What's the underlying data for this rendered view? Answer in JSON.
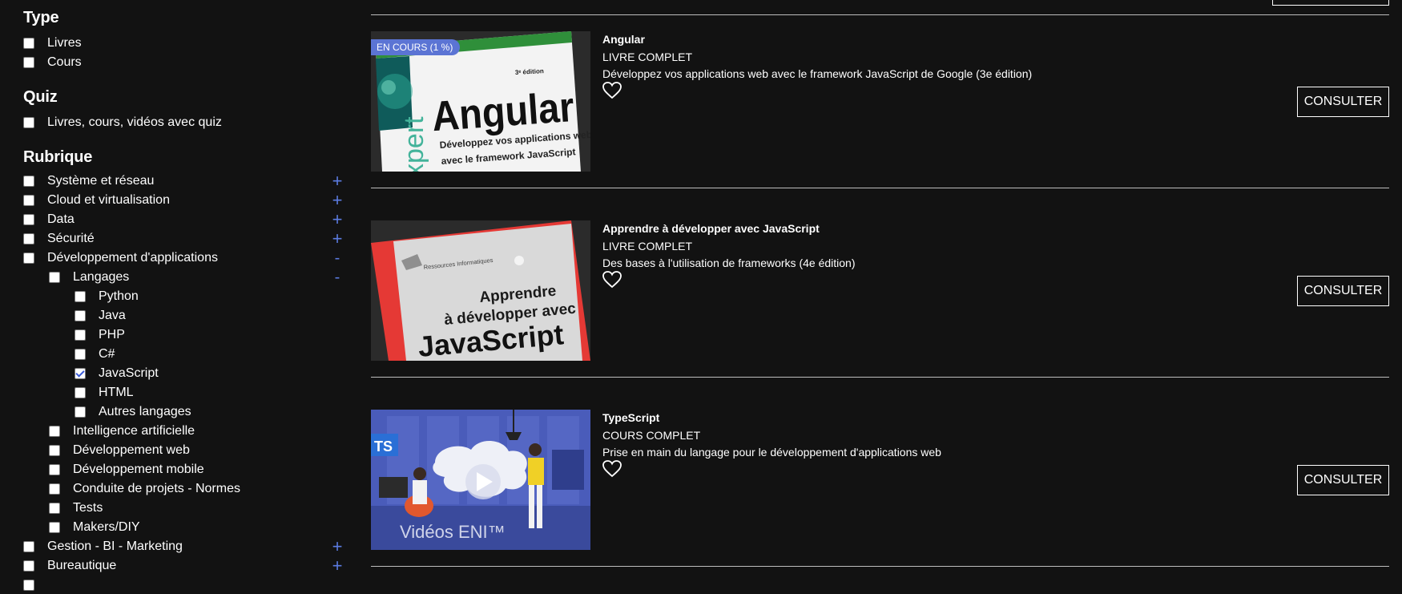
{
  "sidebar": {
    "type": {
      "title": "Type",
      "options": [
        {
          "label": "Livres",
          "checked": false
        },
        {
          "label": "Cours",
          "checked": false
        }
      ]
    },
    "quiz": {
      "title": "Quiz",
      "options": [
        {
          "label": "Livres, cours, vidéos avec quiz",
          "checked": false
        }
      ]
    },
    "rubrique": {
      "title": "Rubrique",
      "items": [
        {
          "label": "Système et réseau",
          "toggle": "+"
        },
        {
          "label": "Cloud et virtualisation",
          "toggle": "+"
        },
        {
          "label": "Data",
          "toggle": "+"
        },
        {
          "label": "Sécurité",
          "toggle": "+"
        },
        {
          "label": "Développement d'applications",
          "toggle": "-"
        }
      ],
      "dev_children": [
        {
          "label": "Langages",
          "toggle": "-"
        },
        {
          "label": "Intelligence artificielle"
        },
        {
          "label": "Développement web"
        },
        {
          "label": "Développement mobile"
        },
        {
          "label": "Conduite de projets - Normes"
        },
        {
          "label": "Tests"
        },
        {
          "label": "Makers/DIY"
        }
      ],
      "languages": [
        {
          "label": "Python",
          "checked": false
        },
        {
          "label": "Java",
          "checked": false
        },
        {
          "label": "PHP",
          "checked": false
        },
        {
          "label": "C#",
          "checked": false
        },
        {
          "label": "JavaScript",
          "checked": true
        },
        {
          "label": "HTML",
          "checked": false
        },
        {
          "label": "Autres langages",
          "checked": false
        }
      ],
      "after_items": [
        {
          "label": "Gestion - BI - Marketing",
          "toggle": "+"
        },
        {
          "label": "Bureautique",
          "toggle": "+"
        }
      ]
    }
  },
  "results": [
    {
      "title": "Angular",
      "type": "LIVRE COMPLET",
      "description": "Développez vos applications web avec le framework JavaScript de Google (3e édition)",
      "badge": "EN COURS (1 %)",
      "button": "CONSULTER",
      "cover": {
        "edition": "3ᵉ édition",
        "heading": "Angular",
        "subtitle_1": "Développez vos applications web",
        "subtitle_2": "avec le framework JavaScript",
        "series": "xpert"
      }
    },
    {
      "title": "Apprendre à développer avec JavaScript",
      "type": "LIVRE COMPLET",
      "description": "Des bases à l'utilisation de frameworks (4e édition)",
      "button": "CONSULTER",
      "cover": {
        "series": "Ressources Informatiques",
        "line_1": "Apprendre",
        "line_2": "à développer avec",
        "line_3": "JavaScript"
      }
    },
    {
      "title": "TypeScript",
      "type": "COURS COMPLET",
      "description": "Prise en main du langage pour le développement d'applications web",
      "button": "CONSULTER",
      "cover": {
        "ts_label": "TS",
        "brand": "Vidéos ENI™"
      }
    }
  ],
  "colors": {
    "background": "#121212",
    "accent": "#5b7be0",
    "badge": "#5b74d4"
  },
  "icons": {
    "favorite": "heart-outline-icon",
    "expand": "plus-icon",
    "collapse": "minus-icon"
  }
}
